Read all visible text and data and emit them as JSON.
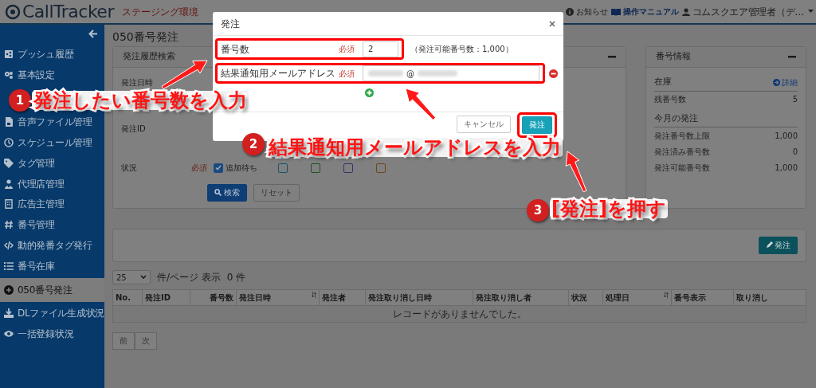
{
  "header": {
    "logo": "CallTracker",
    "environment": "ステージング環境",
    "links": [
      {
        "kind": "info",
        "label": "お知らせ"
      },
      {
        "kind": "manual",
        "label": "操作マニュアル"
      },
      {
        "kind": "user",
        "label": "コムスクエア管理者（デ…"
      }
    ]
  },
  "sidebar": {
    "items": [
      {
        "label": "プッシュ履歴",
        "selected": false
      },
      {
        "label": "基本設定",
        "selected": false
      },
      {
        "label": "音声ファイル管理",
        "selected": false
      },
      {
        "label": "スケジュール管理",
        "selected": false
      },
      {
        "label": "タグ管理",
        "selected": false
      },
      {
        "label": "代理店管理",
        "selected": false
      },
      {
        "label": "広告主管理",
        "selected": false
      },
      {
        "label": "番号管理",
        "selected": false
      },
      {
        "label": "動的発番タグ発行",
        "selected": false
      },
      {
        "label": "番号在庫",
        "selected": false
      },
      {
        "label": "050番号発注",
        "selected": true
      },
      {
        "label": "DLファイル生成状況",
        "selected": false
      },
      {
        "label": "一括登録状況",
        "selected": false
      }
    ]
  },
  "page_title": "050番号発注",
  "search_card": {
    "title": "発注履歴検索",
    "fields": [
      {
        "label": "発注日時"
      },
      {
        "label": "発注ID"
      }
    ],
    "status": {
      "label": "状況",
      "required": "必須",
      "options": [
        {
          "label": "追加待ち",
          "checked": true,
          "color": "#1b4a80"
        },
        {
          "checked": false,
          "color": "#15566a"
        },
        {
          "checked": false,
          "color": "#1d5225"
        },
        {
          "checked": false,
          "color": "#3d2f64"
        },
        {
          "checked": false,
          "color": "#704515"
        }
      ]
    },
    "buttons": [
      {
        "kind": "primary",
        "label": "検索"
      },
      {
        "kind": "secondary",
        "label": "リセット"
      }
    ]
  },
  "info_card": {
    "title": "番号情報",
    "sections": [
      {
        "heading": "在庫",
        "link": "詳細",
        "rows": [
          {
            "label": "残番号数",
            "value": "5"
          }
        ]
      },
      {
        "heading": "今月の発注",
        "rows": [
          {
            "label": "発注番号数上限",
            "value": "1,000"
          },
          {
            "label": "発注済み番号数",
            "value": "0"
          },
          {
            "label": "発注可能番号数",
            "value": "1,000"
          }
        ]
      }
    ]
  },
  "action_card": {
    "button": "発注"
  },
  "table": {
    "page_size": "25",
    "per_page_label": "件/ページ 表示",
    "count": "0 件",
    "columns": [
      {
        "label": "No.",
        "sortable": false
      },
      {
        "label": "発注ID",
        "sortable": false
      },
      {
        "label": "番号数",
        "sortable": false
      },
      {
        "label": "発注日時",
        "sortable": true
      },
      {
        "label": "発注者",
        "sortable": false
      },
      {
        "label": "発注取り消し日時",
        "sortable": false
      },
      {
        "label": "発注取り消し者",
        "sortable": false
      },
      {
        "label": "状況",
        "sortable": false
      },
      {
        "label": "処理日",
        "sortable": true
      },
      {
        "label": "番号表示",
        "sortable": false
      },
      {
        "label": "取り消し",
        "sortable": false
      }
    ],
    "empty_message": "レコードがありませんでした。"
  },
  "pagination": [
    "前",
    "次"
  ],
  "modal": {
    "title": "発注",
    "rows": [
      {
        "kind": "number",
        "label": "番号数",
        "required": "必須",
        "value": "2",
        "note": "（発注可能番号数：1,000）"
      },
      {
        "kind": "email",
        "label": "結果通知用メールアドレス",
        "required": "必須",
        "value": "@"
      }
    ],
    "buttons": [
      {
        "kind": "secondary",
        "label": "キャンセル"
      },
      {
        "kind": "primary",
        "label": "発注"
      }
    ]
  },
  "annotations": [
    {
      "number": "1",
      "text": "発注したい番号数を入力"
    },
    {
      "number": "2",
      "text": "結果通知用メールアドレスを入力"
    },
    {
      "number": "3",
      "text": "[発注]を押す"
    }
  ]
}
